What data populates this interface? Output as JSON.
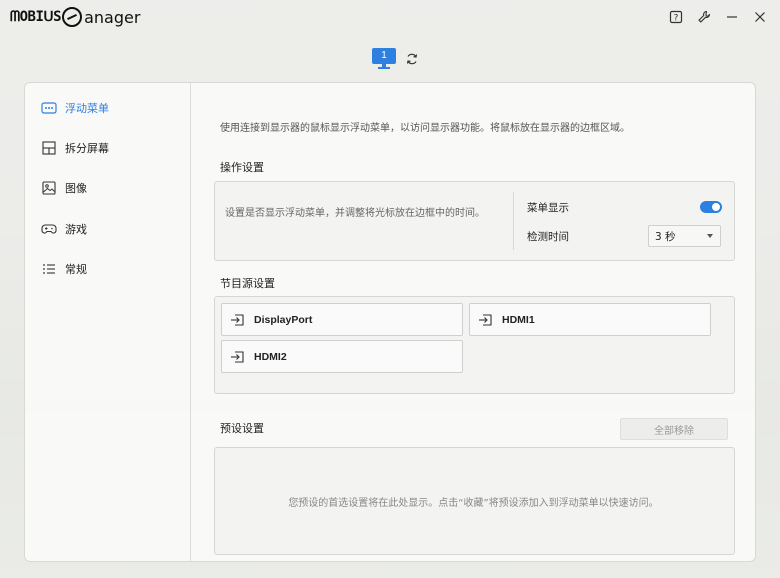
{
  "app": {
    "logo_mark": "MOBIUS",
    "logo_word": "anager"
  },
  "window_controls": {
    "help_icon": "help-icon",
    "settings_icon": "wrench-icon",
    "minimize_icon": "minimize-icon",
    "close_icon": "close-icon"
  },
  "monitor": {
    "number": "1",
    "accent": "#2d7fe0"
  },
  "sidebar": {
    "items": [
      {
        "label": "浮动菜单",
        "icon": "floating-menu-icon",
        "active": true
      },
      {
        "label": "拆分屏幕",
        "icon": "split-screen-icon",
        "active": false
      },
      {
        "label": "图像",
        "icon": "image-icon",
        "active": false
      },
      {
        "label": "游戏",
        "icon": "gamepad-icon",
        "active": false
      },
      {
        "label": "常规",
        "icon": "list-icon",
        "active": false
      }
    ]
  },
  "main": {
    "description": "使用连接到显示器的鼠标显示浮动菜单，以访问显示器功能。将鼠标放在显示器的边框区域。",
    "operation": {
      "title": "操作设置",
      "text": "设置是否显示浮动菜单，并调整将光标放在边框中的时间。",
      "menu_display_label": "菜单显示",
      "menu_display_on": true,
      "detect_time_label": "检测时间",
      "detect_time_value": "3 秒"
    },
    "source": {
      "title": "节目源设置",
      "buttons": [
        "DisplayPort",
        "HDMI1",
        "HDMI2"
      ]
    },
    "preset": {
      "title": "预设设置",
      "clear_all_label": "全部移除",
      "empty_text": "您预设的首选设置将在此处显示。点击“收藏”将预设添加入到浮动菜单以快速访问。"
    }
  }
}
